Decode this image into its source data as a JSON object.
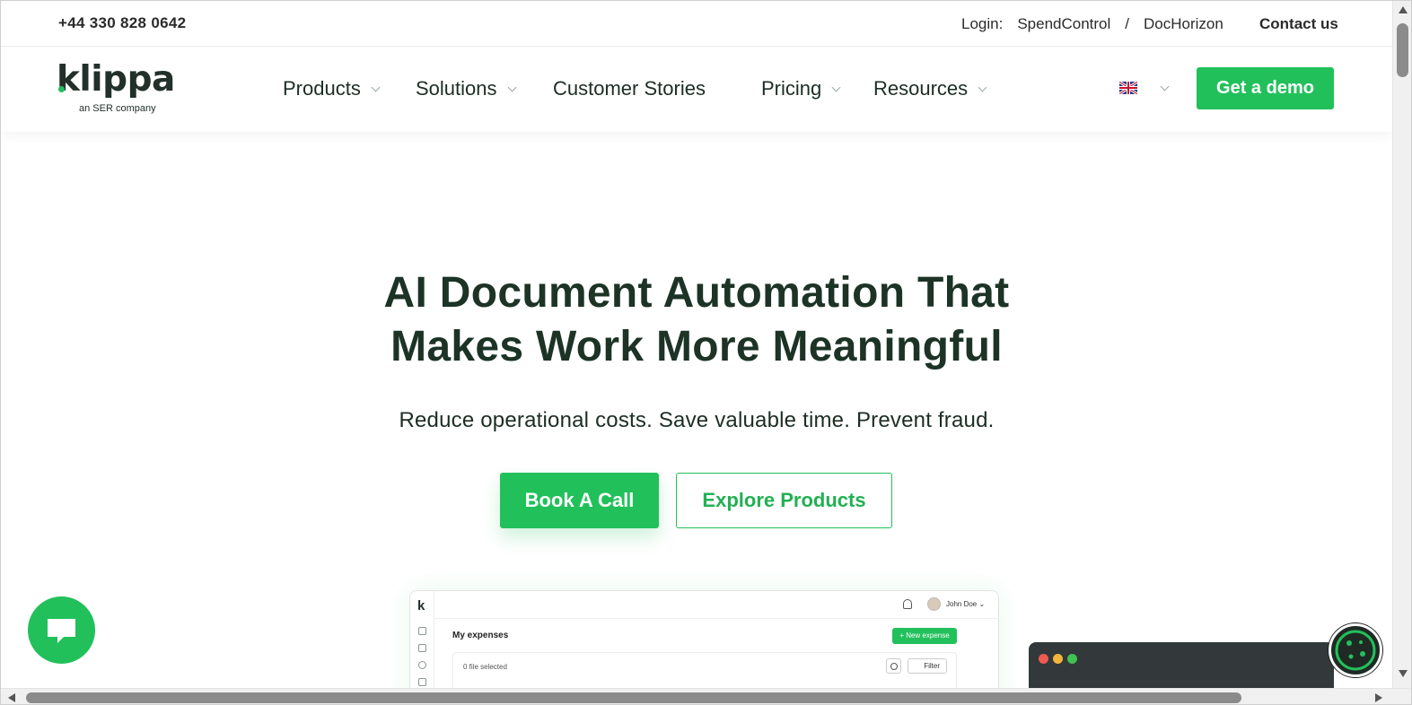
{
  "topbar": {
    "phone": "+44 330 828 0642",
    "login_label": "Login:",
    "login_links": [
      "SpendControl",
      "DocHorizon"
    ],
    "login_separator": "/",
    "contact": "Contact us"
  },
  "nav": {
    "logo_text": "klippa",
    "logo_sub": "an SER company",
    "items": [
      {
        "label": "Products",
        "has_dropdown": true
      },
      {
        "label": "Solutions",
        "has_dropdown": true
      },
      {
        "label": "Customer Stories",
        "has_dropdown": false
      },
      {
        "label": "Pricing",
        "has_dropdown": true
      },
      {
        "label": "Resources",
        "has_dropdown": true
      }
    ],
    "language_flag": "uk-flag-icon",
    "demo_button": "Get a demo"
  },
  "hero": {
    "title_line1": "AI Document Automation That",
    "title_line2": "Makes Work More Meaningful",
    "subtitle": "Reduce operational costs. Save valuable time. Prevent fraud.",
    "primary_button": "Book A Call",
    "secondary_button": "Explore Products"
  },
  "mockup": {
    "logo": "k",
    "user": "John Doe",
    "title": "My expenses",
    "new_button": "+ New expense",
    "selection": "0 file selected",
    "filter": "Filter"
  },
  "colors": {
    "brand_green": "#22c05b",
    "heading": "#1c3326",
    "terminal": "#33383a"
  }
}
